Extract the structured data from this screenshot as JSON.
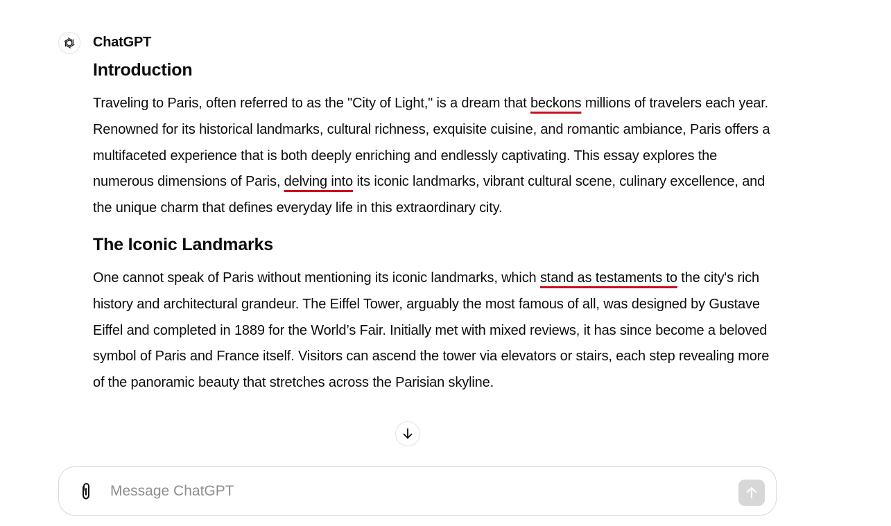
{
  "message": {
    "sender": "ChatGPT",
    "sections": [
      {
        "heading": "Introduction",
        "paragraph": {
          "t1": "Traveling to Paris, often referred to as the \"City of Light,\" is a dream that ",
          "h1": "beckons",
          "t2": " millions of travelers each year. Renowned for its historical landmarks, cultural richness, exquisite cuisine, and romantic ambiance, Paris offers a multifaceted experience that is both deeply enriching and endlessly captivating. This essay explores the numerous dimensions of Paris, ",
          "h2": "delving into",
          "t3": " its iconic landmarks, vibrant cultural scene, culinary excellence, and the unique charm that defines everyday life in this extraordinary city."
        }
      },
      {
        "heading": "The Iconic Landmarks",
        "paragraph": {
          "t1": "One cannot speak of Paris without mentioning its iconic landmarks, which ",
          "h1": "stand as testaments to",
          "t2": " the city's rich history and architectural grandeur. The Eiffel Tower, arguably the most famous of all, was designed by Gustave Eiffel and completed in 1889 for the World’s Fair. Initially met with mixed reviews, it has since become a beloved symbol of Paris and France itself. Visitors can ascend the tower via elevators or stairs, each step revealing more of the panoramic beauty that stretches across the Parisian skyline."
        }
      }
    ]
  },
  "composer": {
    "placeholder": "Message ChatGPT",
    "value": ""
  },
  "icons": {
    "avatar": "openai-logo-icon",
    "scroll": "arrow-down-icon",
    "attach": "paperclip-icon",
    "send": "arrow-up-icon"
  },
  "colors": {
    "highlight_underline": "#c8101e",
    "send_button_disabled": "#d7d7d7"
  }
}
